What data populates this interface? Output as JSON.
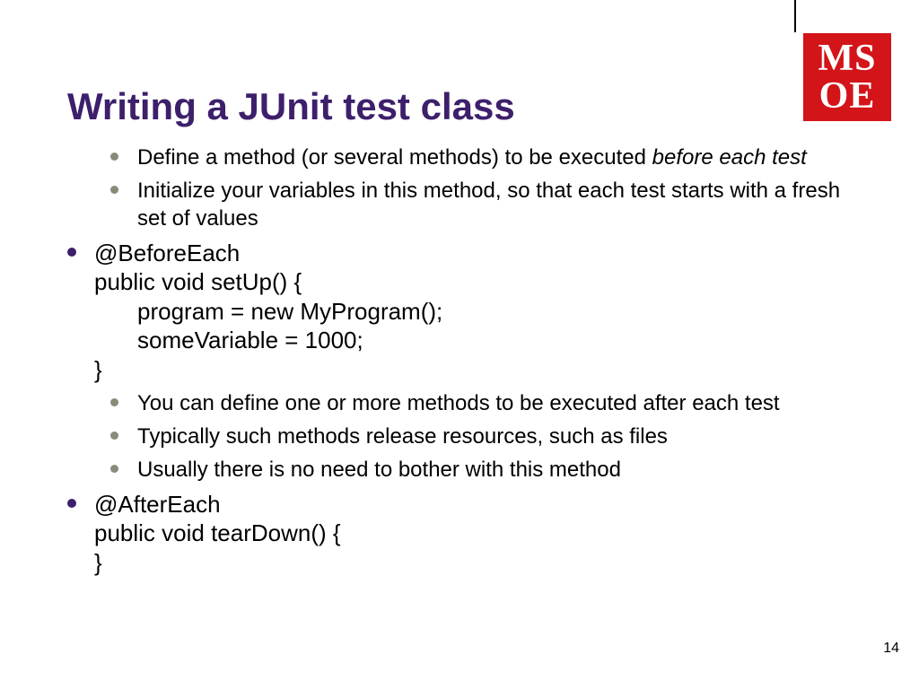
{
  "logo": {
    "row1a": "M",
    "row1b": "S",
    "row2a": "O",
    "row2b": "E"
  },
  "title": "Writing a JUnit test class",
  "bullets": {
    "b1_pre": "Define a method (or several methods) to be executed ",
    "b1_em": "before each test",
    "b2": "Initialize your variables in this method, so that each test starts with a fresh set of values",
    "code1_l1": "@BeforeEach",
    "code1_l2": "public void setUp() {",
    "code1_l3": "program = new MyProgram();",
    "code1_l4": "someVariable = 1000;",
    "code1_l5": "}",
    "b3": "You can define one or more methods to be executed after each test",
    "b4": "Typically such methods release resources, such as files",
    "b5": "Usually there is no need to bother with this method",
    "code2_l1": "@AfterEach",
    "code2_l2": "public void tearDown() {",
    "code2_l3": "}"
  },
  "page_number": "14"
}
